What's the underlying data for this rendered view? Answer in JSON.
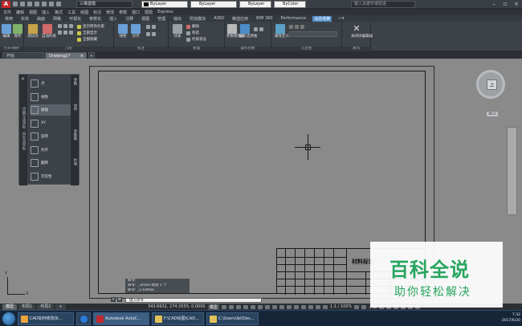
{
  "titlebar": {
    "workspace": "三维建模",
    "layer_dropdown": "ByLayer",
    "linetype_dropdown": "ByLayer",
    "lineweight_dropdown": "ByLayer",
    "color_dropdown": "ByColor",
    "search_placeholder": "键入关键字或短语",
    "app_menu_label": "A"
  },
  "menubar": [
    "文件",
    "编辑",
    "视图",
    "插入",
    "格式",
    "工具",
    "绘图",
    "标注",
    "修改",
    "参数",
    "窗口",
    "帮助",
    "Express"
  ],
  "ribbon_tabs": [
    "常用",
    "实体",
    "曲面",
    "网格",
    "可视化",
    "参数化",
    "插入",
    "注释",
    "视图",
    "管理",
    "输出",
    "附加模块",
    "A360",
    "精选应用",
    "BIM 360",
    "Performance",
    "动态观察",
    "▭▾"
  ],
  "ribbon_active_tab": "动态观察",
  "ribbon": {
    "groups": [
      {
        "title": "打开/保存",
        "buttons": [
          "编辑",
          "保存"
        ]
      },
      {
        "title": "几何",
        "buttons": [
          "测试块",
          "自动约束"
        ]
      },
      {
        "title": "标注",
        "buttons": [
          "线性",
          "对齐"
        ]
      },
      {
        "title": "管理",
        "buttons": [
          "块表"
        ]
      },
      {
        "title": "操作参数",
        "buttons": [
          "参数管理器",
          "编写选项板"
        ]
      },
      {
        "title": "可见性",
        "buttons": [
          "属性定义"
        ]
      },
      {
        "title": "关闭",
        "buttons": [
          "关闭块编辑器"
        ]
      }
    ],
    "small_items": [
      "显示所有约束",
      "全部显示",
      "全部隐藏",
      "删除",
      "构造",
      "约束状态"
    ]
  },
  "file_tabs": {
    "start": "开始",
    "drawing": "Drawing1*",
    "plus": "+"
  },
  "palette": {
    "items": [
      "点",
      "线性",
      "极轴",
      "XY",
      "旋转",
      "对齐",
      "翻转",
      "可见性"
    ],
    "selected_index": 2,
    "side_title": "块编写选项板 - 所有选项板",
    "tabs": [
      "参数",
      "动作",
      "参数集",
      "约束"
    ]
  },
  "navcube": {
    "face": "上",
    "wcs": "WCS"
  },
  "ucs": {
    "x": "X",
    "y": "Y"
  },
  "command": {
    "history": [
      "命令:",
      "命令: _.erase 找到 1 个",
      "命令: _u ERASE"
    ],
    "input_placeholder": "键入命令"
  },
  "layout_tabs": [
    "模型",
    "布局1",
    "布局2",
    "+"
  ],
  "status": {
    "coords": "343.6632, 274.3555, 0.0000",
    "model": "模型",
    "scale": "1:1 / 100%",
    "units": "小数"
  },
  "title_block": {
    "title": "材料标记"
  },
  "taskbar": {
    "tasks": [
      "CAD如何修改块...",
      "Autodesk AutoC...",
      "F:\\CAD绘图\\CAD...",
      "C:\\Users\\ibi\\Des..."
    ],
    "time": "7:32",
    "date": "2017/6/20"
  },
  "watermark": {
    "main": "百科全说",
    "sub": "助你轻松解决"
  },
  "colors": {
    "accent": "#4b8bc9",
    "canvas": "#8a8a8a",
    "ribbon": "#3d4248",
    "watermark": "#27a560",
    "autocad_red": "#c0282d"
  }
}
